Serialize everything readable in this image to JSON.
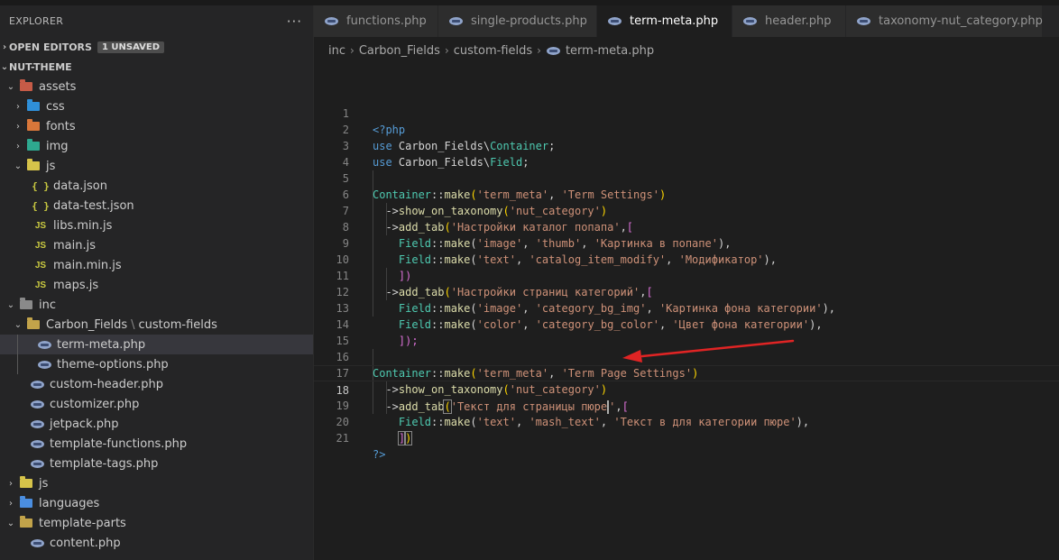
{
  "explorer": {
    "title": "EXPLORER",
    "more": "···",
    "open_editors": {
      "label": "OPEN EDITORS",
      "badge": "1 UNSAVED"
    },
    "workspace": "NUT-THEME",
    "tree": [
      {
        "label": "assets",
        "twisty": "⌄"
      },
      {
        "label": "css",
        "twisty": "›"
      },
      {
        "label": "fonts",
        "twisty": "›"
      },
      {
        "label": "img",
        "twisty": "›"
      },
      {
        "label": "js",
        "twisty": "⌄"
      },
      {
        "label": "data.json",
        "icon": "{ }"
      },
      {
        "label": "data-test.json",
        "icon": "{ }"
      },
      {
        "label": "libs.min.js",
        "icon": "JS"
      },
      {
        "label": "main.js",
        "icon": "JS"
      },
      {
        "label": "main.min.js",
        "icon": "JS"
      },
      {
        "label": "maps.js",
        "icon": "JS"
      },
      {
        "label": "inc",
        "twisty": "⌄"
      },
      {
        "label": "Carbon_Fields",
        "label2": "custom-fields",
        "sep": "\\",
        "twisty": "⌄"
      },
      {
        "label": "term-meta.php"
      },
      {
        "label": "theme-options.php"
      },
      {
        "label": "custom-header.php"
      },
      {
        "label": "customizer.php"
      },
      {
        "label": "jetpack.php"
      },
      {
        "label": "template-functions.php"
      },
      {
        "label": "template-tags.php"
      },
      {
        "label": "js",
        "twisty": "›"
      },
      {
        "label": "languages",
        "twisty": "›"
      },
      {
        "label": "template-parts",
        "twisty": "⌄"
      },
      {
        "label": "content.php"
      }
    ]
  },
  "tabs": [
    {
      "label": "functions.php"
    },
    {
      "label": "single-products.php"
    },
    {
      "label": "term-meta.php",
      "active": true
    },
    {
      "label": "header.php"
    },
    {
      "label": "taxonomy-nut_category.php"
    }
  ],
  "breadcrumb": [
    "inc",
    "Carbon_Fields",
    "custom-fields",
    "term-meta.php"
  ],
  "colors": {
    "folder_assets": "#c65b47",
    "folder_css": "#2f8fd8",
    "folder_fonts": "#d9773a",
    "folder_img": "#2ea88f",
    "folder_js": "#d6c34a",
    "folder_inc": "#8a8a8a",
    "folder_plain": "#c2a34a",
    "folder_languages": "#4b8ee0",
    "arrow": "#e02424"
  },
  "code": {
    "l1": {
      "n": "1",
      "a": "<?php"
    },
    "l2": {
      "n": "2",
      "a": "use",
      "b": "Carbon_Fields\\",
      "c": "Container",
      "d": ";"
    },
    "l3": {
      "n": "3",
      "a": "use",
      "b": "Carbon_Fields\\",
      "c": "Field",
      "d": ";"
    },
    "l4": {
      "n": "4"
    },
    "l5": {
      "n": "5",
      "a": "Container",
      "b": "::",
      "c": "make",
      "d": "(",
      "e": "'term_meta'",
      "f": ", ",
      "g": "'Term Settings'",
      "h": ")"
    },
    "l6": {
      "n": "6",
      "a": "->",
      "b": "show_on_taxonomy",
      "c": "(",
      "d": "'nut_category'",
      "e": ")"
    },
    "l7": {
      "n": "7",
      "a": "->",
      "b": "add_tab",
      "c": "(",
      "d": "'Настройки каталог попапа'",
      "e": ",",
      "f": "["
    },
    "l8": {
      "n": "8",
      "a": "Field",
      "b": "::",
      "c": "make",
      "d": "(",
      "e": "'image'",
      "f": ", ",
      "g": "'thumb'",
      "h": ", ",
      "i": "'Картинка в попапе'",
      "j": "),",
      "k": ""
    },
    "l9": {
      "n": "9",
      "a": "Field",
      "b": "::",
      "c": "make",
      "d": "(",
      "e": "'text'",
      "f": ", ",
      "g": "'catalog_item_modify'",
      "h": ", ",
      "i": "'Модификатор'",
      "j": "),"
    },
    "l10": {
      "n": "10",
      "a": "])"
    },
    "l11": {
      "n": "11",
      "a": "->",
      "b": "add_tab",
      "c": "(",
      "d": "'Настройки страниц категорий'",
      "e": ",",
      "f": "["
    },
    "l12": {
      "n": "12",
      "a": "Field",
      "b": "::",
      "c": "make",
      "d": "(",
      "e": "'image'",
      "f": ", ",
      "g": "'category_bg_img'",
      "h": ", ",
      "i": "'Картинка фона категории'",
      "j": "),"
    },
    "l13": {
      "n": "13",
      "a": "Field",
      "b": "::",
      "c": "make",
      "d": "(",
      "e": "'color'",
      "f": ", ",
      "g": "'category_bg_color'",
      "h": ", ",
      "i": "'Цвет фона категории'",
      "j": "),"
    },
    "l14": {
      "n": "14",
      "a": "]);"
    },
    "l15": {
      "n": "15"
    },
    "l16": {
      "n": "16",
      "a": "Container",
      "b": "::",
      "c": "make",
      "d": "(",
      "e": "'term_meta'",
      "f": ", ",
      "g": "'Term Page Settings'",
      "h": ")"
    },
    "l17": {
      "n": "17",
      "a": "->",
      "b": "show_on_taxonomy",
      "c": "(",
      "d": "'nut_category'",
      "e": ")"
    },
    "l18": {
      "n": "18",
      "a": "->",
      "b": "add_tab",
      "c": "(",
      "d": "'Текст для страницы пюре",
      "d2": "'",
      "e": ",",
      "f": "["
    },
    "l19": {
      "n": "19",
      "a": "Field",
      "b": "::",
      "c": "make",
      "d": "(",
      "e": "'text'",
      "f": ", ",
      "g": "'mash_text'",
      "h": ", ",
      "i": "'Текст в для категории пюре'",
      "j": "),"
    },
    "l20": {
      "n": "20",
      "a": "]",
      "b": ")"
    },
    "l21": {
      "n": "21",
      "a": "?>"
    }
  }
}
